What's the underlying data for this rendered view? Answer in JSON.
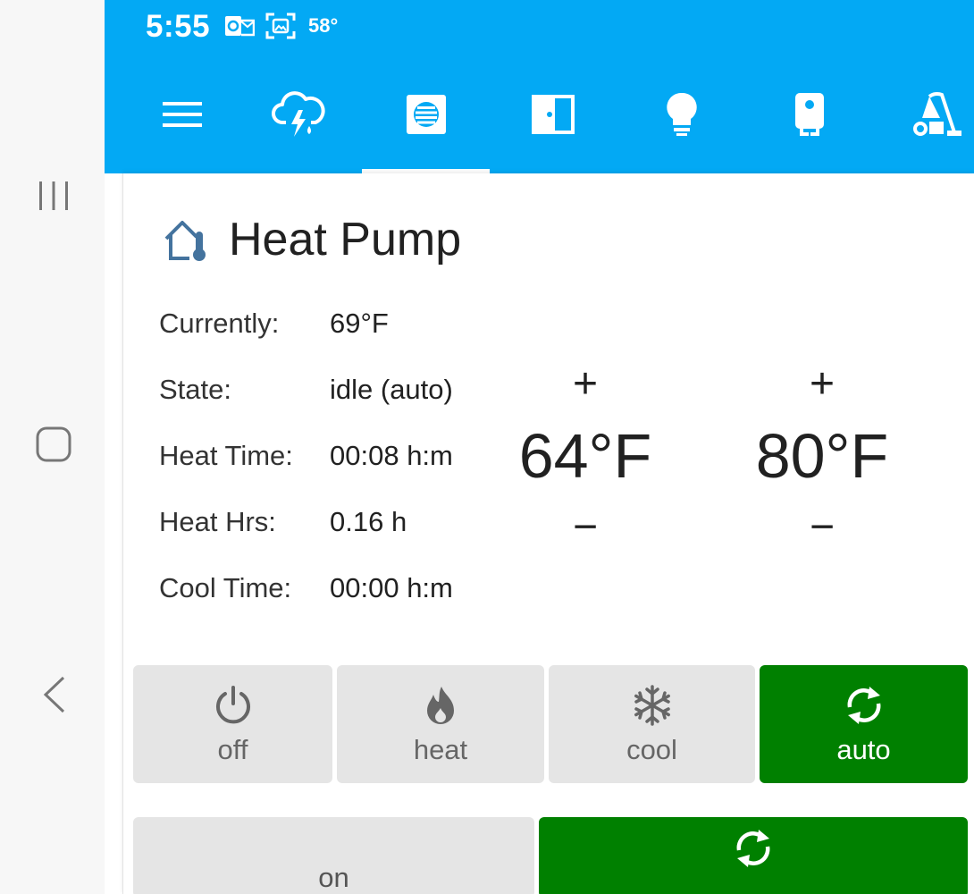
{
  "status_bar": {
    "time": "5:55",
    "temperature": "58°",
    "icons": [
      "outlook-icon",
      "screenshot-icon"
    ]
  },
  "tabs": [
    {
      "icon": "menu-icon"
    },
    {
      "icon": "weather-lightning-rain-icon"
    },
    {
      "icon": "hvac-icon",
      "active": true
    },
    {
      "icon": "door-icon"
    },
    {
      "icon": "lightbulb-icon"
    },
    {
      "icon": "water-heater-icon"
    },
    {
      "icon": "robot-vacuum-icon"
    }
  ],
  "card": {
    "title": "Heat Pump",
    "title_icon": "home-thermometer-icon",
    "info": {
      "currently_label": "Currently:",
      "currently_value": "69°F",
      "state_label": "State:",
      "state_value": "idle (auto)",
      "heat_time_label": "Heat Time:",
      "heat_time_value": "00:08 h:m",
      "heat_hrs_label": "Heat Hrs:",
      "heat_hrs_value": "0.16 h",
      "cool_time_label": "Cool Time:",
      "cool_time_value": "00:00 h:m"
    },
    "setpoints": {
      "low": "64°F",
      "high": "80°F",
      "plus": "+",
      "minus": "−"
    },
    "modes": {
      "off": "off",
      "heat": "heat",
      "cool": "cool",
      "auto": "auto",
      "selected": "auto"
    },
    "fan": {
      "on": "on",
      "selected": "auto"
    }
  },
  "colors": {
    "app_bar": "#03a9f4",
    "active_button": "#008000",
    "inactive_button": "#e5e5e5"
  }
}
